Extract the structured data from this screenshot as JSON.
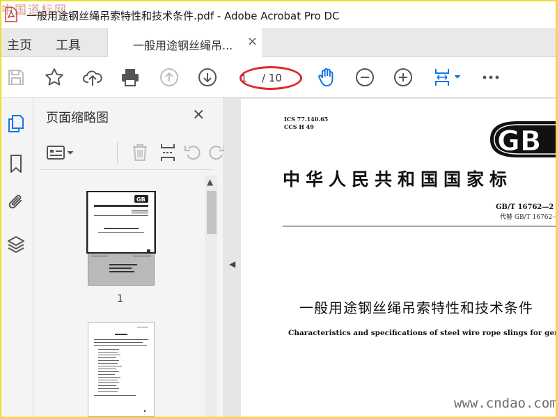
{
  "window": {
    "title": "一般用途钢丝绳吊索特性和技术条件.pdf - Adobe Acrobat Pro DC",
    "watermark_top_left": "中国道标网"
  },
  "tabs": {
    "home": "主页",
    "tools": "工具",
    "document": "一般用途钢丝绳吊...",
    "close": "×"
  },
  "toolbar": {
    "icons": [
      "save-icon",
      "star-icon",
      "cloud-upload-icon",
      "print-icon",
      "page-up-icon",
      "page-down-icon",
      "hand-icon",
      "zoom-out-icon",
      "zoom-in-icon",
      "fit-page-icon",
      "more-icon"
    ],
    "current_page": "1",
    "page_total": "/ 10"
  },
  "left_rail": {
    "icons": [
      "pages-icon",
      "bookmark-icon",
      "attachment-icon",
      "layers-icon"
    ]
  },
  "thumbnails_panel": {
    "title": "页面缩略图",
    "close": "×",
    "page_numbers": [
      "1"
    ]
  },
  "document": {
    "ics": "ICS 77.140.65",
    "ccs": "CCS H 49",
    "logo": "GB",
    "title_line": "中华人民共和国国家标",
    "standard_number": "GB/T 16762—2",
    "replaces": "代替 GB/T 16762—",
    "title_cn": "一般用途钢丝绳吊索特性和技术条件",
    "title_en": "Characteristics and specifications of steel wire rope slings for general purp"
  },
  "watermark_bottom_right": "www.cndao.com",
  "colors": {
    "accent_blue": "#1473e6",
    "annotation_red": "#e0262a",
    "frame_yellow": "#f1dc2e"
  }
}
